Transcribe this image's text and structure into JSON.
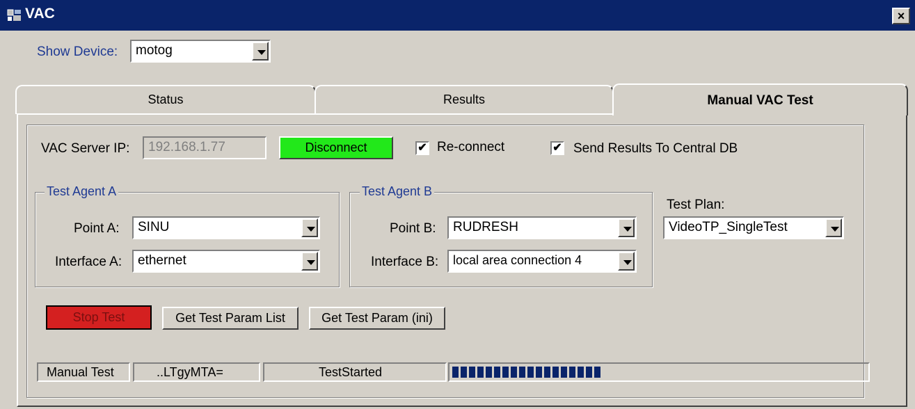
{
  "window": {
    "title": "VAC",
    "close_glyph": "×"
  },
  "show_device": {
    "label": "Show Device:",
    "value": "motog"
  },
  "tabs": [
    {
      "label": "Status",
      "active": false
    },
    {
      "label": "Results",
      "active": false
    },
    {
      "label": "Manual VAC Test",
      "active": true
    }
  ],
  "server": {
    "label": "VAC Server IP:",
    "value": "192.168.1.77",
    "disconnect_label": "Disconnect",
    "disconnect_color": "#22e81a",
    "reconnect_label": "Re-connect",
    "reconnect_checked": true,
    "send_results_label": "Send Results To Central DB",
    "send_results_checked": true
  },
  "agent_a": {
    "title": "Test Agent A",
    "point_label": "Point A:",
    "point_value": "SINU",
    "interface_label": "Interface A:",
    "interface_value": "ethernet"
  },
  "agent_b": {
    "title": "Test Agent B",
    "point_label": "Point B:",
    "point_value": "RUDRESH",
    "interface_label": "Interface B:",
    "interface_value": "local area connection 4"
  },
  "test_plan": {
    "label": "Test Plan:",
    "value": "VideoTP_SingleTest"
  },
  "actions": {
    "stop_label": "Stop Test",
    "stop_color": "#d42020",
    "param_list_label": "Get Test Param List",
    "param_ini_label": "Get Test Param (ini)"
  },
  "status_bar": {
    "mode": "Manual Test",
    "token": "..LTgyMTA=",
    "state": "TestStarted",
    "progress_blocks": 18,
    "progress_color": "#0a246a"
  },
  "checkmark": "✔",
  "icons": [
    "window-icon",
    "close-icon",
    "chevron-down-icon",
    "checkmark-icon"
  ]
}
